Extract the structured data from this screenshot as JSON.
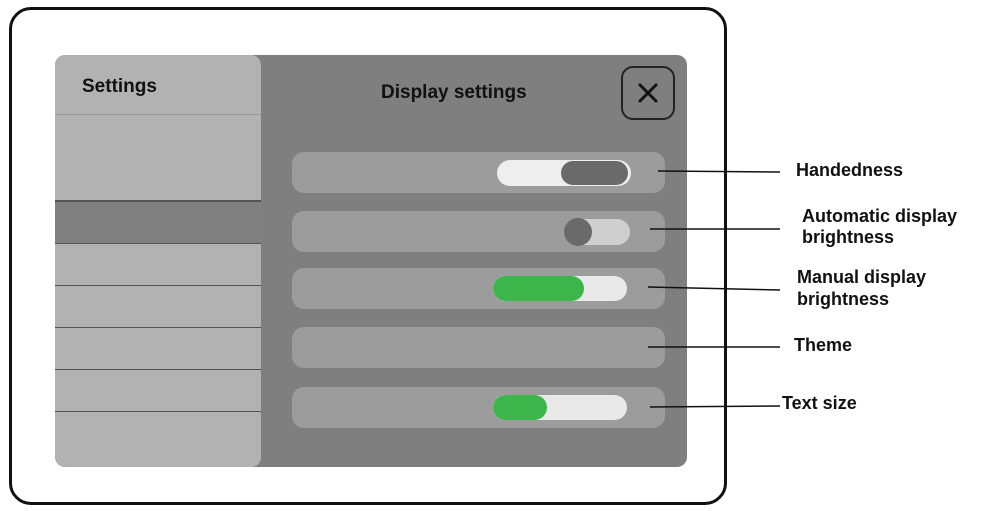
{
  "sidebar": {
    "title": "Settings"
  },
  "panel": {
    "title": "Display settings",
    "close_icon": "close-icon"
  },
  "settings": {
    "handedness": {
      "state": "right"
    },
    "auto_brightness": {
      "on": false
    },
    "manual_brightness": {
      "level": 0.68
    },
    "text_size": {
      "level": 0.4
    }
  },
  "callouts": {
    "handedness": "Handedness",
    "auto_brightness_line1": "Automatic display",
    "auto_brightness_line2": "brightness",
    "manual_brightness_line1": "Manual display",
    "manual_brightness_line2": "brightness",
    "theme": "Theme",
    "text_size": "Text size"
  },
  "colors": {
    "accent_green": "#3cb54a",
    "panel_gray": "#7f7f7f",
    "sidebar_gray": "#b2b2b2",
    "row_gray": "#9c9c9c"
  }
}
